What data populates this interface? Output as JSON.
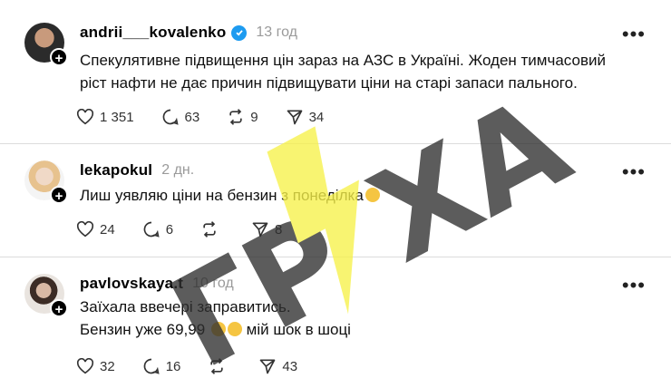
{
  "posts": [
    {
      "username": "andrii___kovalenko",
      "time": "13 год",
      "text_lines": [
        "Спекулятивне підвищення цін зараз на АЗС в Україні. Жоден тимчасовий",
        "ріст нафти не дає причин підвищувати ціни на старі запаси пального."
      ],
      "likes": "1 351",
      "replies": "63",
      "reposts": "9",
      "shares": "34"
    },
    {
      "username": "lekapokul",
      "time": "2 дн.",
      "text_lines": [
        "Лиш уявляю ціни на бензин з понеділка"
      ],
      "likes": "24",
      "replies": "6",
      "reposts": "",
      "shares": "8"
    },
    {
      "username": "pavlovskaya.t",
      "time": "10 год",
      "text_lines": [
        "Заїхала ввечері заправитись.",
        "Бензин уже 69,99",
        "мій шок в шоці"
      ],
      "likes": "32",
      "replies": "16",
      "reposts": "",
      "shares": "43"
    }
  ],
  "icons": {
    "like": "heart-icon",
    "reply": "comment-icon",
    "repost": "repost-icon",
    "share": "share-icon",
    "verified": "verified-badge-icon",
    "more": "more-icon",
    "follow": "plus-icon"
  },
  "colors": {
    "verified": "#1d9bf0",
    "watermark_yellow": "#f7f14a",
    "watermark_gray": "#2f2f2f"
  },
  "watermark": {
    "text": "ГРУХА"
  }
}
